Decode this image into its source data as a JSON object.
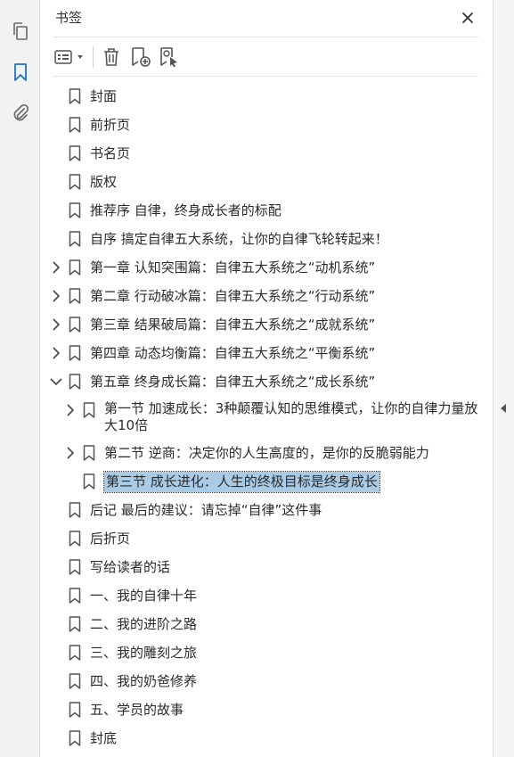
{
  "panel": {
    "title": "书签",
    "toolbar": [
      "options-icon",
      "trash-icon",
      "new-bookmark-icon",
      "bookmark-from-selection-icon"
    ]
  },
  "rail": [
    "pages-icon",
    "bookmark-icon",
    "attachment-icon"
  ],
  "bookmarks": [
    {
      "label": "封面",
      "level": 0,
      "expander": "none"
    },
    {
      "label": "前折页",
      "level": 0,
      "expander": "none"
    },
    {
      "label": "书名页",
      "level": 0,
      "expander": "none"
    },
    {
      "label": "版权",
      "level": 0,
      "expander": "none"
    },
    {
      "label": "推荐序 自律，终身成长者的标配",
      "level": 0,
      "expander": "none"
    },
    {
      "label": "自序 搞定自律五大系统，让你的自律飞轮转起来！",
      "level": 0,
      "expander": "none"
    },
    {
      "label": "第一章 认知突围篇：自律五大系统之“动机系统”",
      "level": 0,
      "expander": "collapsed"
    },
    {
      "label": "第二章 行动破冰篇：自律五大系统之“行动系统”",
      "level": 0,
      "expander": "collapsed"
    },
    {
      "label": "第三章 结果破局篇：自律五大系统之“成就系统”",
      "level": 0,
      "expander": "collapsed"
    },
    {
      "label": "第四章 动态均衡篇：自律五大系统之“平衡系统”",
      "level": 0,
      "expander": "collapsed"
    },
    {
      "label": "第五章 终身成长篇：自律五大系统之“成长系统”",
      "level": 0,
      "expander": "expanded"
    },
    {
      "label": "第一节 加速成长：3种颠覆认知的思维模式，让你的自律力量放大10倍",
      "level": 1,
      "expander": "collapsed",
      "wrap": true
    },
    {
      "label": "第二节 逆商：决定你的人生高度的，是你的反脆弱能力",
      "level": 1,
      "expander": "collapsed"
    },
    {
      "label": "第三节 成长进化：人生的终极目标是终身成长",
      "level": 1,
      "expander": "none",
      "selected": true
    },
    {
      "label": "后记 最后的建议：请忘掉“自律”这件事",
      "level": 0,
      "expander": "none"
    },
    {
      "label": "后折页",
      "level": 0,
      "expander": "none"
    },
    {
      "label": "写给读者的话",
      "level": 0,
      "expander": "none"
    },
    {
      "label": "一、我的自律十年",
      "level": 0,
      "expander": "none"
    },
    {
      "label": "二、我的进阶之路",
      "level": 0,
      "expander": "none"
    },
    {
      "label": "三、我的雕刻之旅",
      "level": 0,
      "expander": "none"
    },
    {
      "label": "四、我的奶爸修养",
      "level": 0,
      "expander": "none"
    },
    {
      "label": "五、学员的故事",
      "level": 0,
      "expander": "none"
    },
    {
      "label": "封底",
      "level": 0,
      "expander": "none"
    }
  ],
  "colors": {
    "accent": "#1a73c8",
    "selection": "#a9cbe6",
    "icon": "#666666"
  }
}
